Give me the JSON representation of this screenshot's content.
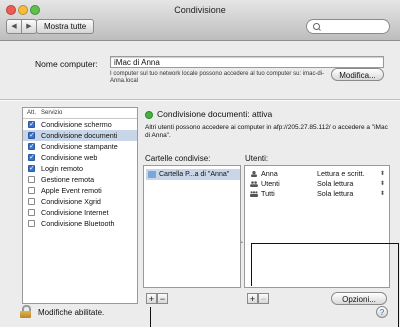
{
  "window": {
    "title": "Condivisione"
  },
  "toolbar": {
    "back_icon": "chevron-left-icon",
    "forward_icon": "chevron-right-icon",
    "show_all_label": "Mostra tutte",
    "search_placeholder": ""
  },
  "computer": {
    "name_label": "Nome computer:",
    "name_value": "iMac di Anna",
    "note": "I computer sul tuo network locale possono accedere al tuo computer su: imac-di-Anna.local",
    "modify_label": "Modifica..."
  },
  "services": {
    "header_on": "Att.",
    "header_service": "Servizio",
    "items": [
      {
        "label": "Condivisione schermo",
        "checked": true
      },
      {
        "label": "Condivisione documenti",
        "checked": true,
        "selected": true
      },
      {
        "label": "Condivisione stampante",
        "checked": true
      },
      {
        "label": "Condivisione web",
        "checked": true
      },
      {
        "label": "Login remoto",
        "checked": true
      },
      {
        "label": "Gestione remota",
        "checked": false
      },
      {
        "label": "Apple Event remoti",
        "checked": false
      },
      {
        "label": "Condivisione Xgrid",
        "checked": false
      },
      {
        "label": "Condivisione Internet",
        "checked": false
      },
      {
        "label": "Condivisione Bluetooth",
        "checked": false
      }
    ]
  },
  "status": {
    "text": "Condivisione documenti: attiva",
    "color": "#43b33b",
    "description": "Altri utenti possono accedere ai computer in afp://205.27.85.112/ o accedere a \"iMac di Anna\"."
  },
  "folders": {
    "label": "Cartelle condivise:",
    "items": [
      "Cartella P...a di \"Anna\""
    ]
  },
  "users": {
    "label": "Utenti:",
    "items": [
      {
        "name": "Anna",
        "permission": "Lettura e scritt.",
        "icon": "single-user-icon"
      },
      {
        "name": "Utenti",
        "permission": "Sola lettura",
        "icon": "group-icon"
      },
      {
        "name": "Tutti",
        "permission": "Sola lettura",
        "icon": "everyone-icon"
      }
    ],
    "options_label": "Opzioni..."
  },
  "footer": {
    "lock_text": "Modifiche abilitate.",
    "help_label": "?"
  },
  "colors": {
    "selection": "#c9d6e8",
    "checkbox_on": "#3b73c9",
    "status_green": "#43b33b"
  }
}
